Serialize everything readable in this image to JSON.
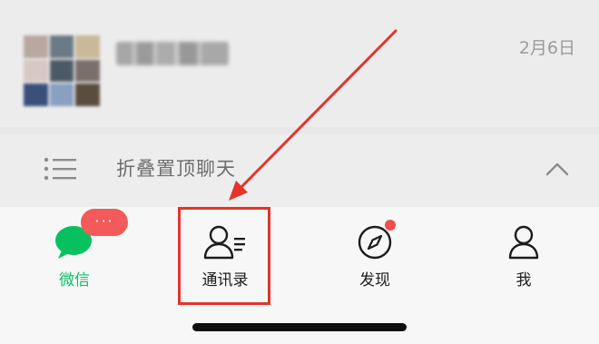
{
  "chat_list": {
    "group_chat": {
      "name": "",
      "time": "2月6日",
      "avatar_colors": [
        "#b8a8a0",
        "#6b7a86",
        "#c9b89a",
        "#d7c8c4",
        "#4d5a66",
        "#7b6f6a",
        "#3a4f7a",
        "#8aa0c0",
        "#5a4d3f"
      ]
    },
    "folded_pinned": {
      "label": "折叠置顶聊天",
      "icon": "list-icon",
      "toggle_icon": "chevron-up-icon"
    }
  },
  "tab_bar": {
    "tabs": [
      {
        "label": "微信",
        "icon": "chat-bubble-icon",
        "active": true,
        "badge": "···"
      },
      {
        "label": "通讯录",
        "icon": "contacts-icon",
        "active": false,
        "highlighted": true
      },
      {
        "label": "发现",
        "icon": "compass-icon",
        "active": false,
        "dot": true
      },
      {
        "label": "我",
        "icon": "person-icon",
        "active": false
      }
    ]
  },
  "colors": {
    "accent": "#07c160",
    "badge": "#f45a5a",
    "annotation": "#e5332a"
  }
}
